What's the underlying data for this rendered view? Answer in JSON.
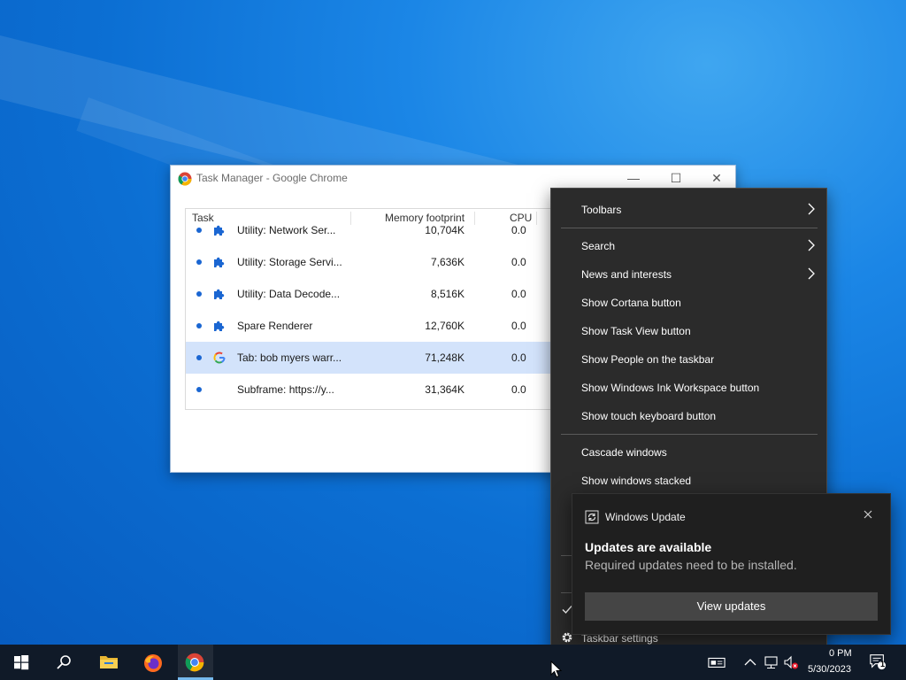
{
  "task_manager": {
    "title": "Task Manager - Google Chrome",
    "controls": {
      "minimize": "—",
      "maximize": "☐",
      "close": "✕"
    },
    "columns": {
      "task": "Task",
      "memory": "Memory footprint",
      "cpu": "CPU"
    },
    "rows": [
      {
        "icon": "puzzle-icon",
        "name": "Utility: Network Ser...",
        "memory": "10,704K",
        "cpu": "0.0",
        "selected": false
      },
      {
        "icon": "puzzle-icon",
        "name": "Utility: Storage Servi...",
        "memory": "7,636K",
        "cpu": "0.0",
        "selected": false
      },
      {
        "icon": "puzzle-icon",
        "name": "Utility: Data Decode...",
        "memory": "8,516K",
        "cpu": "0.0",
        "selected": false
      },
      {
        "icon": "puzzle-icon",
        "name": "Spare Renderer",
        "memory": "12,760K",
        "cpu": "0.0",
        "selected": false
      },
      {
        "icon": "google-icon",
        "name": "Tab: bob myers warr...",
        "memory": "71,248K",
        "cpu": "0.0",
        "selected": true
      },
      {
        "icon": "none",
        "name": "Subframe: https://y...",
        "memory": "31,364K",
        "cpu": "0.0",
        "selected": false
      }
    ]
  },
  "context_menu": {
    "items": [
      {
        "label": "Toolbars",
        "submenu": true
      },
      {
        "label": "Search",
        "submenu": true
      },
      {
        "label": "News and interests",
        "submenu": true
      },
      {
        "label": "Show Cortana button",
        "submenu": false
      },
      {
        "label": "Show Task View button",
        "submenu": false
      },
      {
        "label": "Show People on the taskbar",
        "submenu": false
      },
      {
        "label": "Show Windows Ink Workspace button",
        "submenu": false
      },
      {
        "label": "Show touch keyboard button",
        "submenu": false
      },
      {
        "label": "Cascade windows",
        "submenu": false
      },
      {
        "label": "Show windows stacked",
        "submenu": false
      }
    ],
    "taskbar_settings": "Taskbar settings",
    "lock_checked": true
  },
  "toast": {
    "app_name": "Windows Update",
    "title": "Updates are available",
    "body": "Required updates need to be installed.",
    "button": "View updates"
  },
  "taskbar": {
    "pinned": [
      "start-icon",
      "search-icon",
      "file-explorer-icon",
      "firefox-icon",
      "chrome-icon"
    ],
    "active_app": "chrome-icon",
    "clock_time": "0 PM",
    "clock_date": "5/30/2023",
    "notification_count": "1"
  },
  "colors": {
    "desktop": "#0c6fd3",
    "menu_bg": "#2b2b2b",
    "toast_bg": "#1f1f1f",
    "selection": "#d3e3fb",
    "accent": "#1a66d2"
  }
}
